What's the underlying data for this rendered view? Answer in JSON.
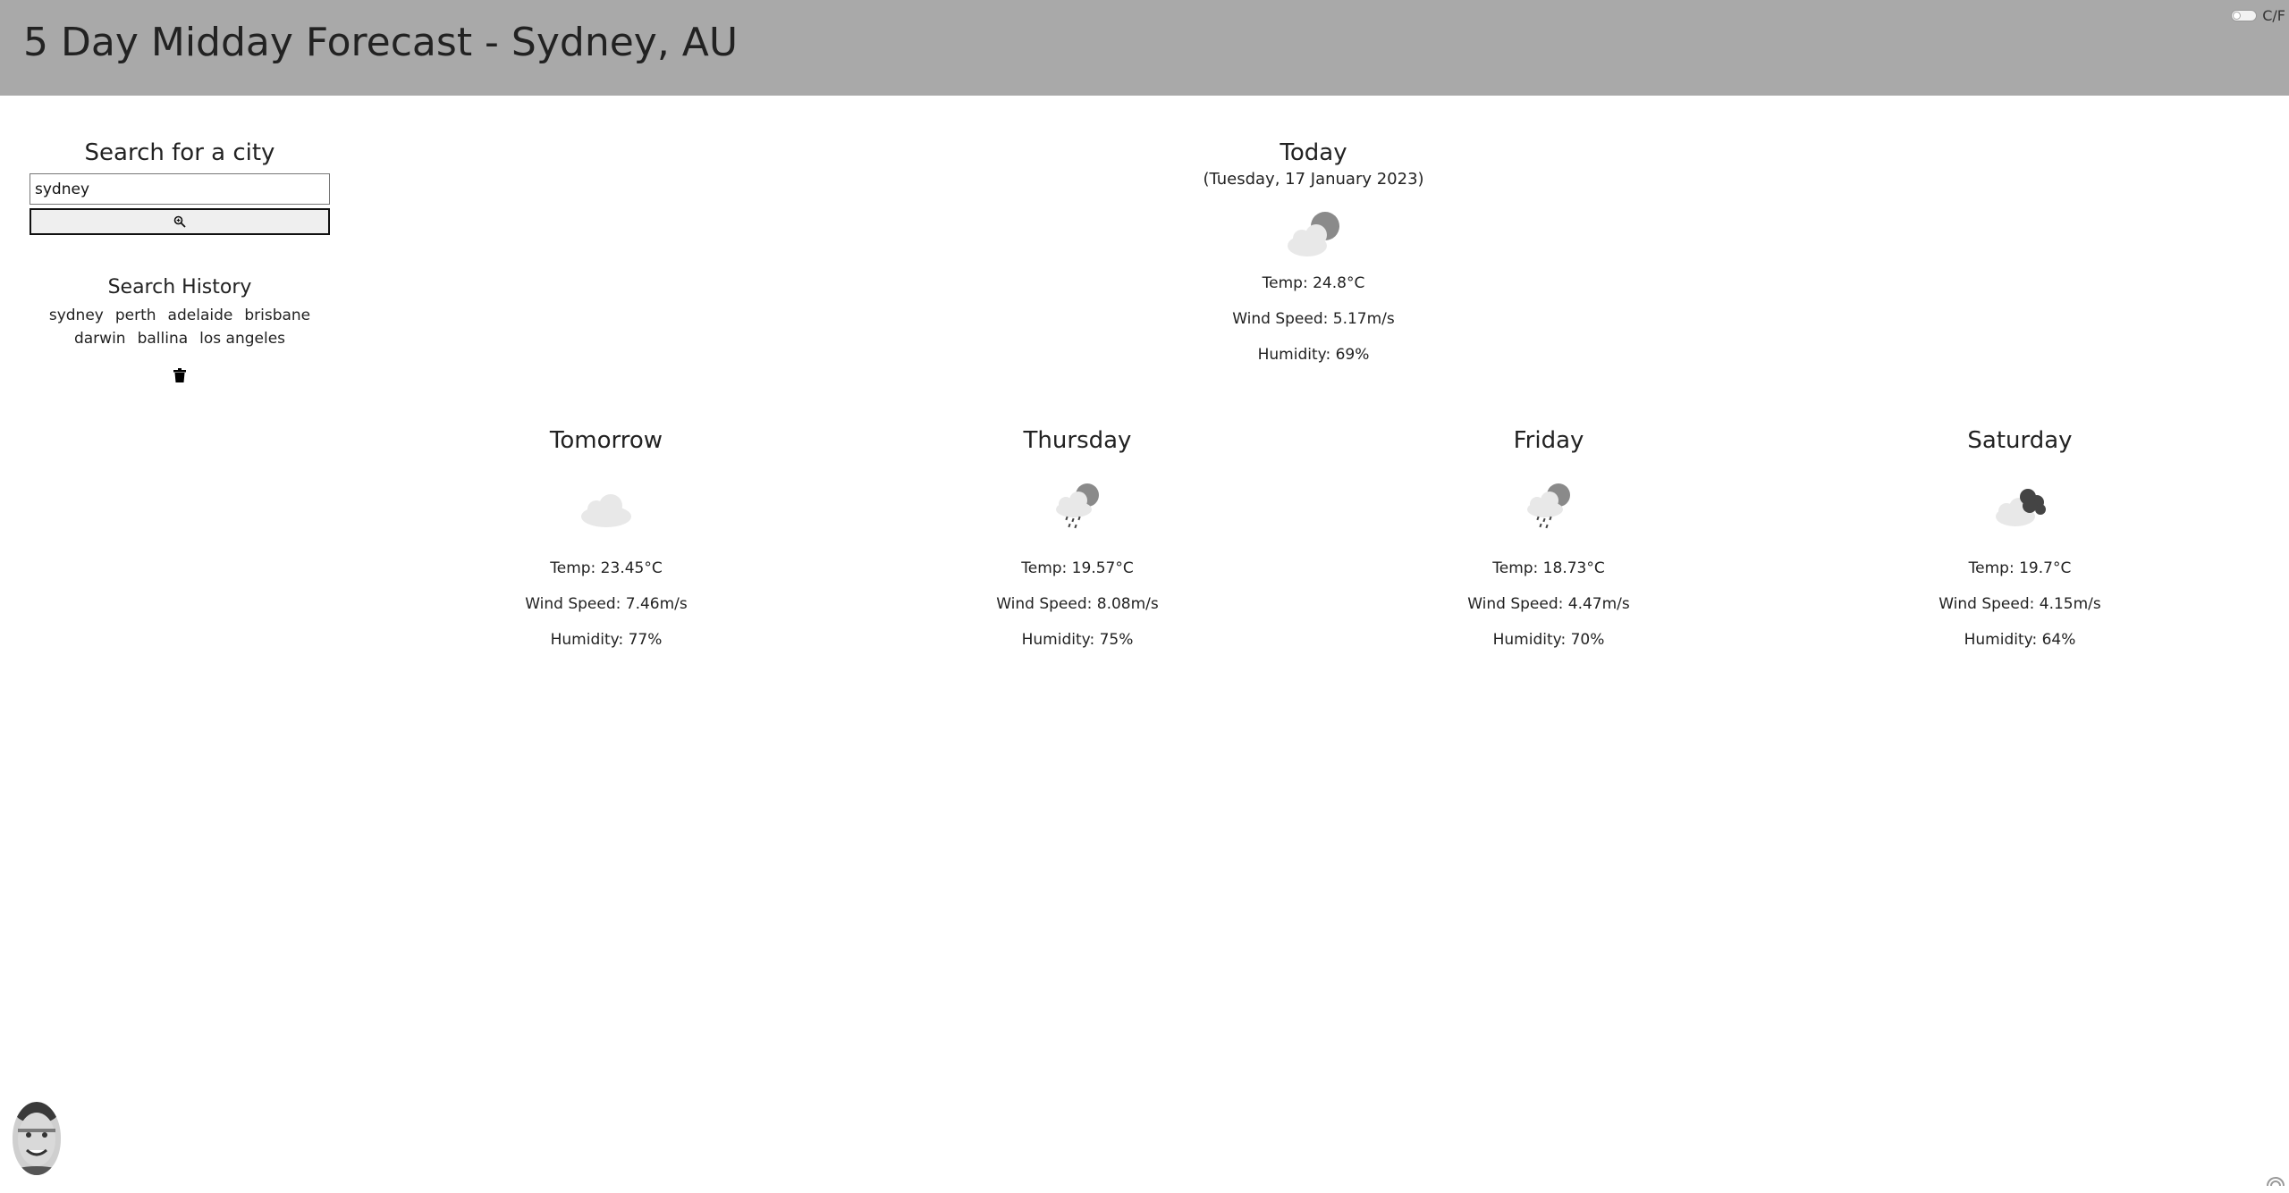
{
  "header": {
    "title": "5 Day Midday Forecast - Sydney, AU",
    "unit_toggle_label": "C/F"
  },
  "sidebar": {
    "search_heading": "Search for a city",
    "search_value": "sydney",
    "search_icon": "magnifier-icon",
    "history_heading": "Search History",
    "history": [
      "sydney",
      "perth",
      "adelaide",
      "brisbane",
      "darwin",
      "ballina",
      "los angeles"
    ],
    "clear_icon": "trash-icon"
  },
  "today": {
    "label": "Today",
    "date": "(Tuesday, 17 January 2023)",
    "icon": "cloud-moon-icon",
    "temp": "Temp: 24.8°C",
    "wind": "Wind Speed: 5.17m/s",
    "humidity": "Humidity: 69%"
  },
  "forecast": [
    {
      "label": "Tomorrow",
      "icon": "cloud-icon",
      "temp": "Temp: 23.45°C",
      "wind": "Wind Speed: 7.46m/s",
      "humidity": "Humidity: 77%"
    },
    {
      "label": "Thursday",
      "icon": "cloud-moon-rain-icon",
      "temp": "Temp: 19.57°C",
      "wind": "Wind Speed: 8.08m/s",
      "humidity": "Humidity: 75%"
    },
    {
      "label": "Friday",
      "icon": "cloud-moon-rain-icon",
      "temp": "Temp: 18.73°C",
      "wind": "Wind Speed: 4.47m/s",
      "humidity": "Humidity: 70%"
    },
    {
      "label": "Saturday",
      "icon": "broken-clouds-icon",
      "temp": "Temp: 19.7°C",
      "wind": "Wind Speed: 4.15m/s",
      "humidity": "Humidity: 64%"
    }
  ],
  "colors": {
    "header_bg": "#a9a9a9",
    "cloud_light": "#e8e8e8",
    "moon": "#8a8a8a",
    "dark_cloud": "#444444"
  }
}
